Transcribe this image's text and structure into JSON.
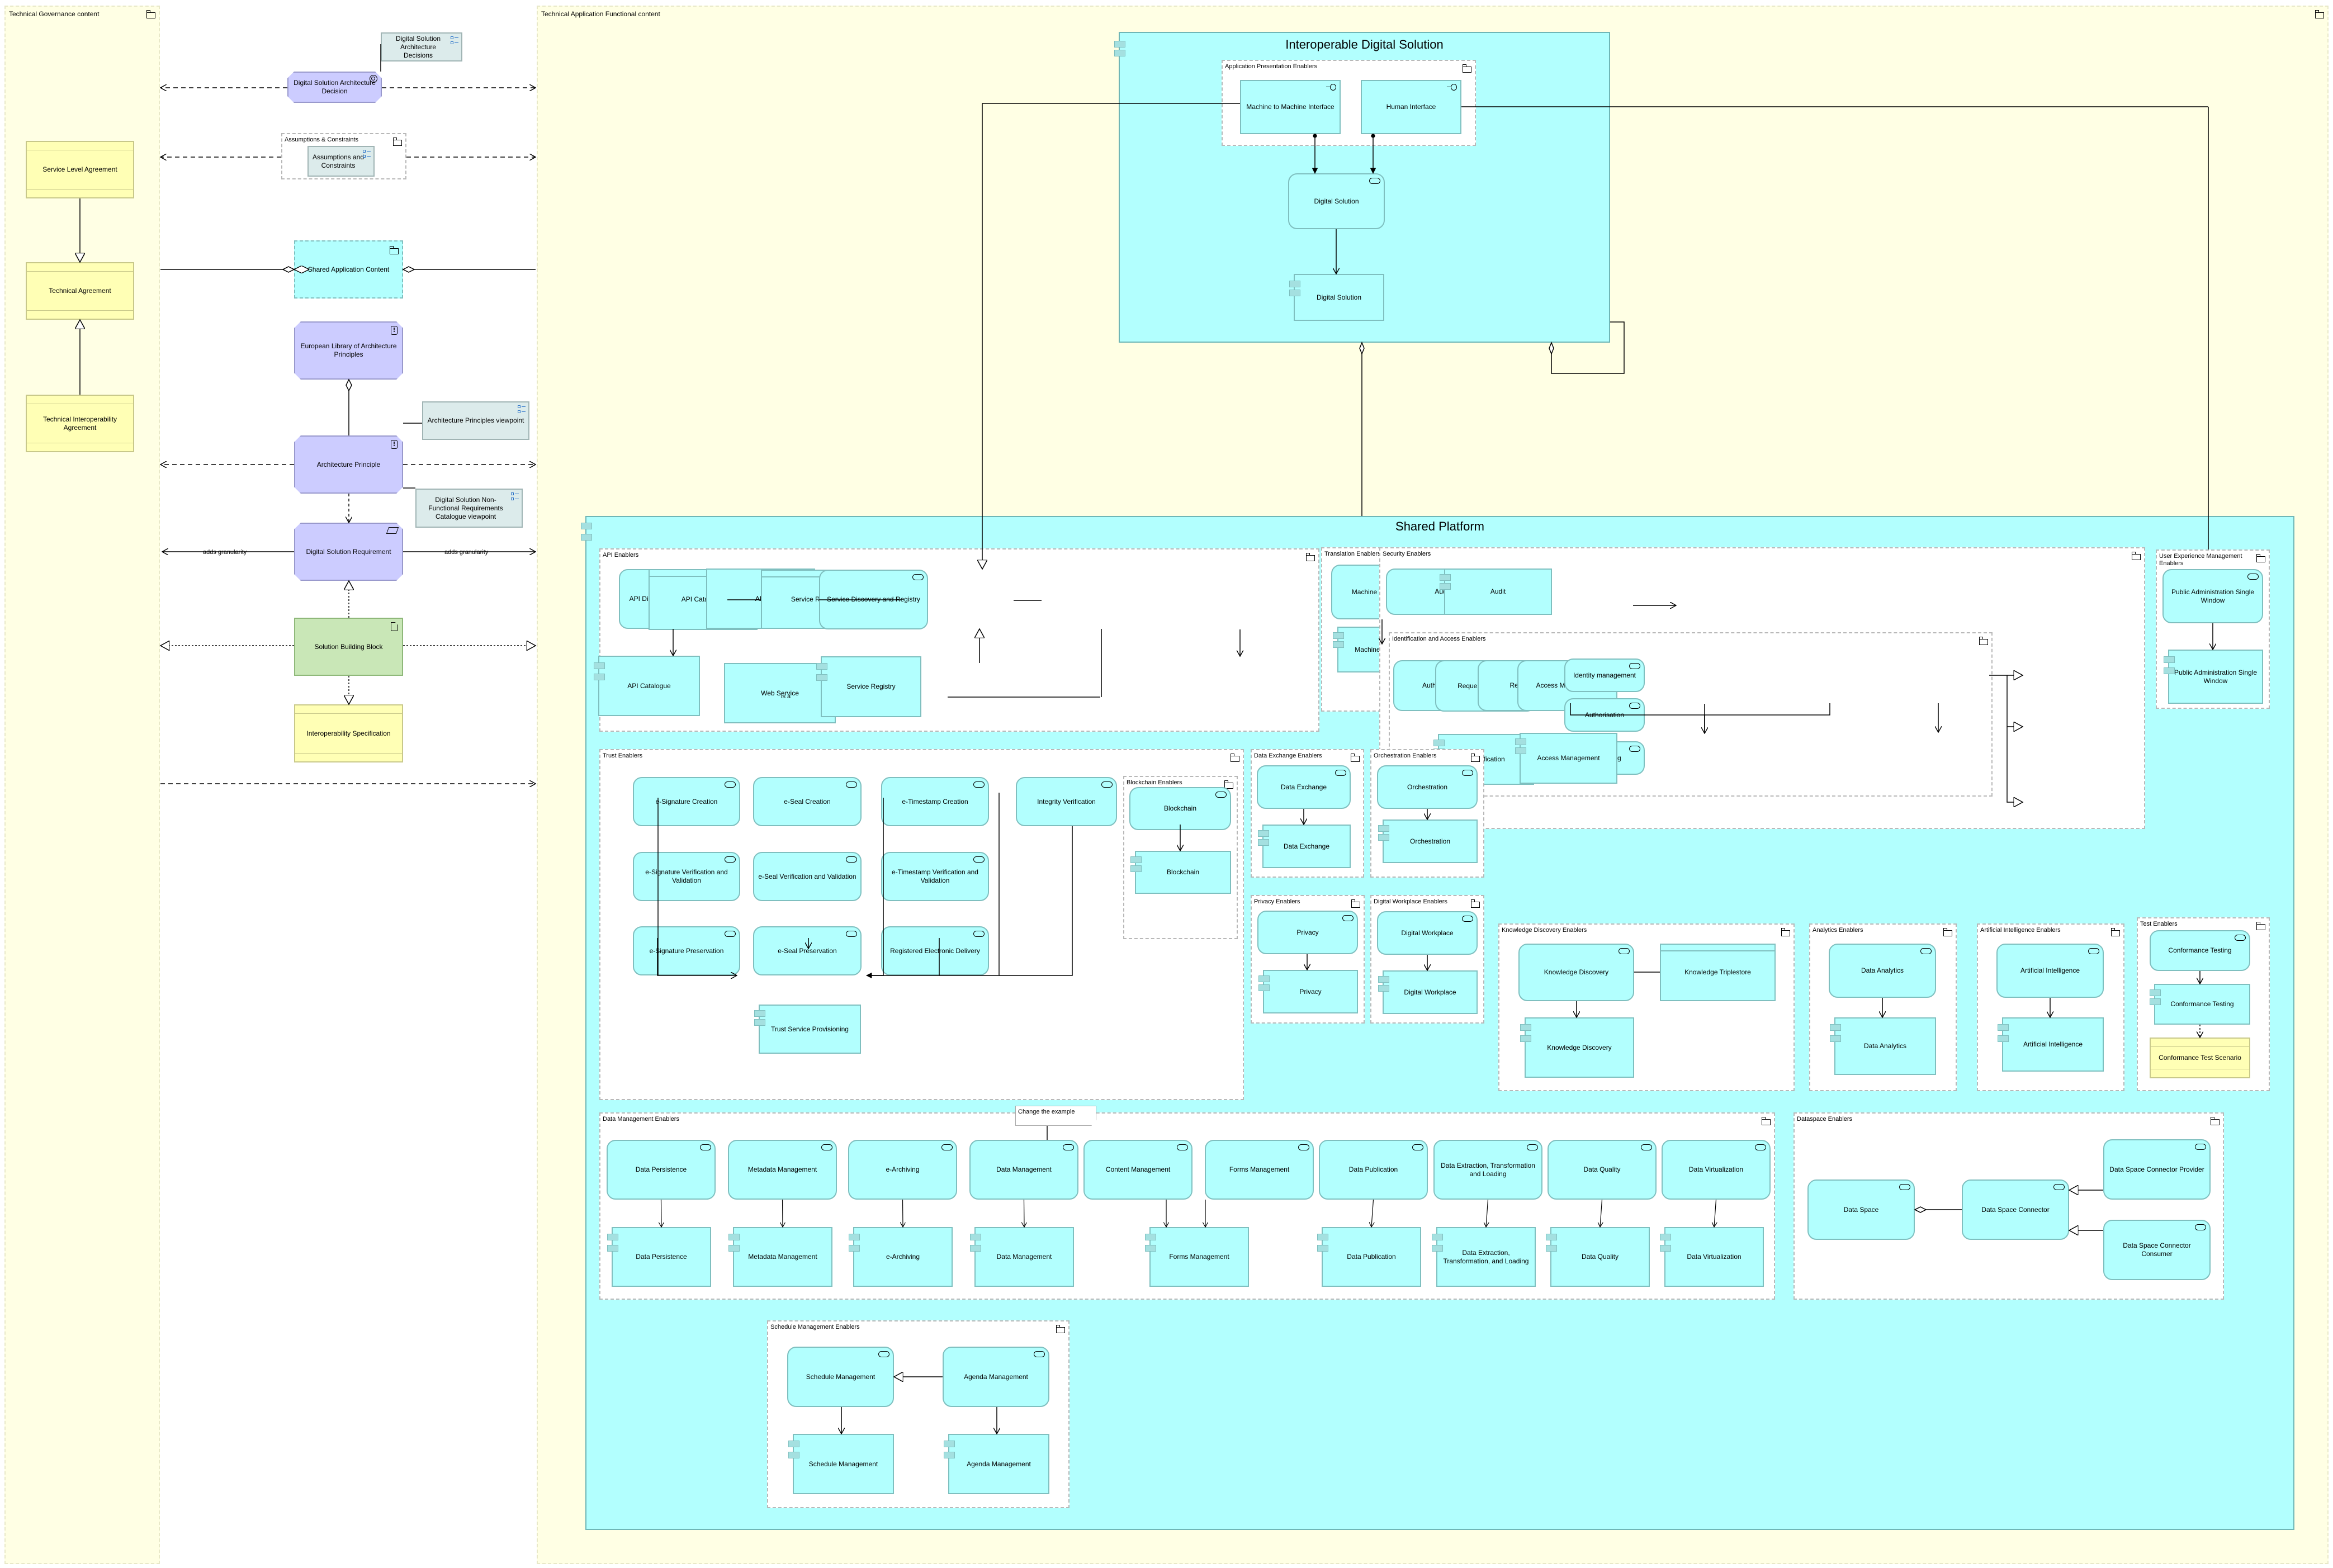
{
  "zones": {
    "governance": {
      "title": "Technical Governance content"
    },
    "functional": {
      "title": "Technical Application Functional content"
    }
  },
  "governance": {
    "service_level_agreement": "Service Level Agreement",
    "technical_agreement": "Technical Agreement",
    "technical_interoperability_agreement": "Technical Interoperability Agreement"
  },
  "middle": {
    "architecture_decisions_view": "Digital Solution Architecture Decisions",
    "architecture_decision": "Digital Solution Architecture Decision",
    "assumptions_group": "Assumptions & Constraints",
    "assumptions_view": "Assumptions and Constraints",
    "shared_application_content": "Shared Application Content",
    "elap": "European Library of Architecture Principles",
    "principles_viewpoint": "Architecture Principles viewpoint",
    "architecture_principle": "Architecture Principle",
    "nfr_viewpoint": "Digital Solution Non-Functional Requirements Catalogue viewpoint",
    "requirement": "Digital Solution Requirement",
    "adds_granularity_left": "adds granularity",
    "adds_granularity_right": "adds granularity",
    "sbb": "Solution Building Block",
    "interop_spec": "Interoperability Specification"
  },
  "ids": {
    "title": "Interoperable Digital Solution",
    "presentation_group": "Application Presentation Enablers",
    "m2m_interface": "Machine to Machine Interface",
    "human_interface": "Human Interface",
    "ds_service": "Digital Solution",
    "ds_component": "Digital Solution"
  },
  "platform": {
    "title": "Shared Platform",
    "api": {
      "title": "API Enablers",
      "discovery_service": "API Discovery and Catalogue",
      "catalogue_object": "API Catalogue",
      "api_interface": "API",
      "registry_object": "Service Registry",
      "registry_service": "Service Discovery and Registry",
      "catalogue_component": "API Catalogue",
      "web_service": "Web Service",
      "is_a": "is a",
      "registry_component": "Service Registry"
    },
    "translation": {
      "title": "Translation Enablers",
      "service": "Machine Translation",
      "component": "Machine Translation"
    },
    "security": {
      "title": "Security Enablers",
      "audit_service": "Audit",
      "audit_component": "Audit",
      "iam": {
        "title": "Identification and Access Enablers",
        "authentication": "Authentication",
        "request_validation": "Request Validation",
        "registration": "Registration",
        "access_management": "Access Management",
        "identity_management": "Identity management",
        "authorisation": "Authorisation",
        "accounting": "Accounting",
        "identification_component": "Identification",
        "access_management_component": "Access Management"
      }
    },
    "ux": {
      "title": "User Experience Management Enablers",
      "service": "Public Administration Single Window",
      "component": "Public Administration Single Window"
    },
    "trust": {
      "title": "Trust Enablers",
      "esig_creation": "e-Signature Creation",
      "eseal_creation": "e-Seal Creation",
      "etimestamp_creation": "e-Timestamp Creation",
      "integrity_verification": "Integrity Verification",
      "esig_verification": "e-Signature Verification and Validation",
      "eseal_verification": "e-Seal Verification and Validation",
      "etimestamp_verification": "e-Timestamp Verification and Validation",
      "esig_preservation": "e-Signature Preservation",
      "eseal_preservation": "e-Seal Preservation",
      "registered_delivery": "Registered Electronic Delivery",
      "trust_provisioning": "Trust Service Provisioning",
      "blockchain": {
        "title": "Blockchain Enablers",
        "service": "Blockchain",
        "component": "Blockchain"
      }
    },
    "data_exchange": {
      "title": "Data Exchange Enablers",
      "service": "Data Exchange",
      "component": "Data Exchange"
    },
    "orchestration": {
      "title": "Orchestration Enablers",
      "service": "Orchestration",
      "component": "Orchestration"
    },
    "privacy": {
      "title": "Privacy Enablers",
      "service": "Privacy",
      "component": "Privacy"
    },
    "workplace": {
      "title": "Digital Workplace Enablers",
      "service": "Digital Workplace",
      "component": "Digital Workplace"
    },
    "knowledge": {
      "title": "Knowledge Discovery Enablers",
      "service": "Knowledge Discovery",
      "triplestore": "Knowledge Triplestore",
      "component": "Knowledge Discovery"
    },
    "analytics": {
      "title": "Analytics Enablers",
      "service": "Data Analytics",
      "component": "Data Analytics"
    },
    "ai": {
      "title": "Artificial Intelligence Enablers",
      "service": "Artificial Intelligence",
      "component": "Artificial Intelligence"
    },
    "test": {
      "title": "Test Enablers",
      "service": "Conformance Testing",
      "component": "Conformance Testing",
      "scenario": "Conformance Test Scenario"
    },
    "data_mgmt": {
      "title": "Data Management Enablers",
      "note": "Change the example",
      "services": [
        "Data Persistence",
        "Metadata Management",
        "e-Archiving",
        "Data Management",
        "Content Management",
        "Forms Management",
        "Data Publication",
        "Data Extraction, Transformation and Loading",
        "Data Quality",
        "Data Virtualization"
      ],
      "components": [
        "Data Persistence",
        "Metadata Management",
        "e-Archiving",
        "Data Management",
        "Forms Management",
        "Data Publication",
        "Data Extraction, Transformation, and Loading",
        "Data Quality",
        "Data Virtualization"
      ]
    },
    "dataspace": {
      "title": "Dataspace Enablers",
      "data_space": "Data Space",
      "connector": "Data Space Connector",
      "provider": "Data Space Connector Provider",
      "consumer": "Data Space Connector Consumer"
    },
    "schedule": {
      "title": "Schedule Management Enablers",
      "schedule_service": "Schedule Management",
      "agenda_service": "Agenda Management",
      "schedule_component": "Schedule Management",
      "agenda_component": "Agenda Management"
    }
  }
}
